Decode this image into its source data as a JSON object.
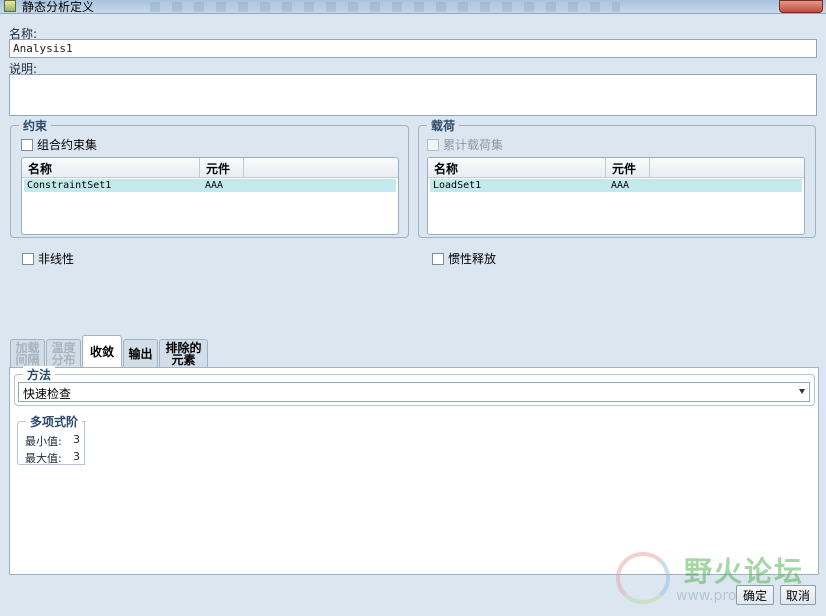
{
  "window": {
    "title": "静态分析定义"
  },
  "name": {
    "label": "名称:",
    "value": "Analysis1"
  },
  "description": {
    "label": "说明:",
    "value": ""
  },
  "constraints": {
    "title": "约束",
    "combine_label": "组合约束集",
    "columns": [
      "名称",
      "元件"
    ],
    "rows": [
      {
        "name": "ConstraintSet1",
        "component": "AAA"
      }
    ],
    "nonlinear_label": "非线性"
  },
  "loads": {
    "title": "载荷",
    "accumulate_label": "累计载荷集",
    "columns": [
      "名称",
      "元件"
    ],
    "rows": [
      {
        "name": "LoadSet1",
        "component": "AAA"
      }
    ],
    "inertia_label": "惯性释放"
  },
  "tabs": [
    {
      "label": "加载\n间隔"
    },
    {
      "label": "温度\n分布"
    },
    {
      "label": "收敛"
    },
    {
      "label": "输出"
    },
    {
      "label": "排除的\n元素"
    }
  ],
  "method": {
    "title": "方法",
    "selected": "快速检查"
  },
  "polynomial": {
    "title": "多项式阶",
    "min_label": "最小值:",
    "min_value": "3",
    "max_label": "最大值:",
    "max_value": "3"
  },
  "buttons": {
    "ok": "确定",
    "cancel": "取消"
  },
  "watermark": {
    "title": "野火论坛",
    "url": "www.pro"
  },
  "colors": {
    "selected_row": "#c3e9ec",
    "group_title": "#2d4a6b",
    "background": "#dbe6f0"
  }
}
